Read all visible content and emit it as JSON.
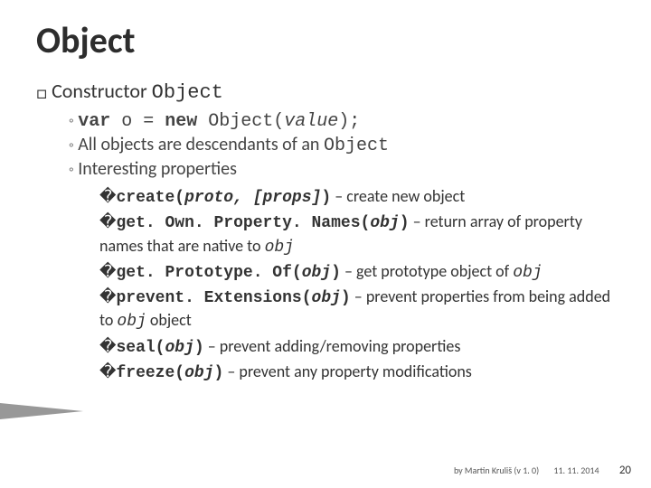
{
  "title": "Object",
  "l1_prefix": "Constructor ",
  "l1_mono": "Object",
  "l2a": {
    "kw1": "var",
    "mid": " o = ",
    "kw2": "new",
    "post": " Object(",
    "arg": "value",
    "close": ");"
  },
  "l2b": {
    "pre": "All objects are descendants of an ",
    "mono": "Object"
  },
  "l2c": "Interesting properties",
  "props": [
    {
      "call_pre": "create(",
      "arg": "proto, [props]",
      "call_post": ")",
      "desc_pre": " – create new object",
      "tail": ""
    },
    {
      "call_pre": "get. Own. Property. Names(",
      "arg": "obj",
      "call_post": ")",
      "desc_pre": " – return array of property names that are native to ",
      "tail": "obj"
    },
    {
      "call_pre": "get. Prototype. Of(",
      "arg": "obj",
      "call_post": ")",
      "desc_pre": " – get prototype object of ",
      "tail": "obj"
    },
    {
      "call_pre": "prevent. Extensions(",
      "arg": "obj",
      "call_post": ")",
      "desc_pre": " – prevent properties from being added to ",
      "tail": "obj",
      "desc_post": " object"
    },
    {
      "call_pre": "seal(",
      "arg": "obj",
      "call_post": ")",
      "desc_pre": " – prevent adding/removing properties",
      "tail": ""
    },
    {
      "call_pre": "freeze(",
      "arg": "obj",
      "call_post": ")",
      "desc_pre": " – prevent any property modifications",
      "tail": ""
    }
  ],
  "footer": {
    "author": "by Martin Kruliš (v 1. 0)",
    "date": "11. 11. 2014",
    "page": "20"
  },
  "glyphs": {
    "square": "□",
    "ring": "◦",
    "box": "�"
  }
}
